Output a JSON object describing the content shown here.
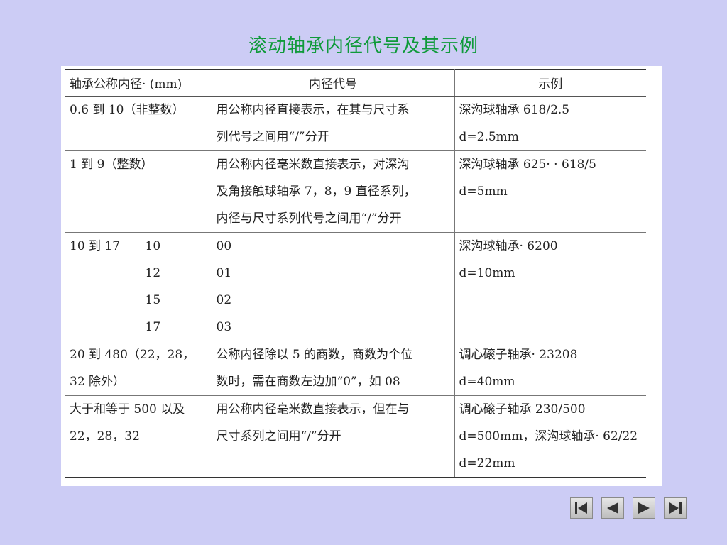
{
  "slide": {
    "title": "滚动轴承内径代号及其示例"
  },
  "table": {
    "headers": [
      "轴承公称内径· (mm)",
      "内径代号",
      "示例"
    ],
    "rows": [
      {
        "bore": "0.6 到 10（非整数）",
        "code_lines": [
          "用公称内径直接表示，在其与尺寸系",
          "列代号之间用“/”分开"
        ],
        "example_lines": [
          "深沟球轴承 618/2.5",
          "d=2.5mm"
        ]
      },
      {
        "bore": "1 到 9（整数）",
        "code_lines": [
          "用公称内径毫米数直接表示，对深沟",
          "及角接触球轴承 7，8，9 直径系列，",
          "内径与尺寸系列代号之间用“/”分开"
        ],
        "example_lines": [
          "深沟球轴承 625· · 618/5",
          "d=5mm"
        ]
      },
      {
        "bore": "10 到 17",
        "sub_bores": [
          "10",
          "12",
          "15",
          "17"
        ],
        "codes": [
          "00",
          "01",
          "02",
          "03"
        ],
        "example_lines": [
          "深沟球轴承· 6200",
          "d=10mm"
        ]
      },
      {
        "bore_lines": [
          "20  到  480（22，28，",
          "32 除外）"
        ],
        "code_lines": [
          "公称内径除以 5 的商数，商数为个位",
          "数时，需在商数左边加“0”，如 08"
        ],
        "example_lines": [
          "调心磙子轴承· 23208",
          "d=40mm"
        ]
      },
      {
        "bore_lines": [
          "大于和等于  500 以及",
          "22，28，32"
        ],
        "code_lines": [
          "用公称内径毫米数直接表示，但在与",
          "尺寸系列之间用“/”分开"
        ],
        "example_lines": [
          "调心磙子轴承 230/500",
          "d=500mm，深沟球轴承· 62/22",
          "d=22mm"
        ]
      }
    ]
  },
  "navigation": {
    "buttons": [
      "first",
      "previous",
      "next",
      "last"
    ]
  }
}
